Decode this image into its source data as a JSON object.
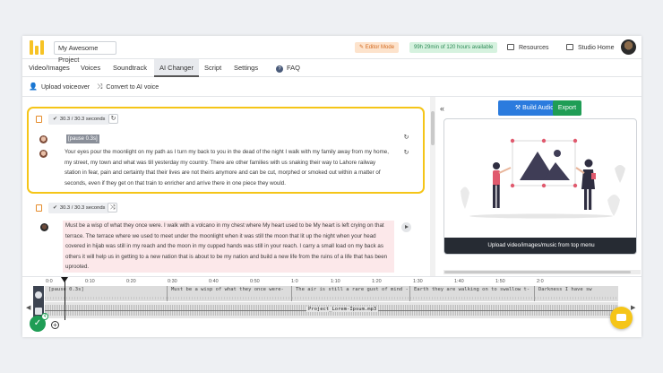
{
  "header": {
    "project_name": "My Awesome Project",
    "editor_mode": "Editor Mode",
    "hours_badge": "99h 29min of 120 hours available",
    "resources": "Resources",
    "studio_home": "Studio Home"
  },
  "tabs": [
    {
      "label": "Video/Images"
    },
    {
      "label": "Voices"
    },
    {
      "label": "Soundtrack"
    },
    {
      "label": "AI Changer"
    },
    {
      "label": "Script"
    },
    {
      "label": "Settings"
    },
    {
      "label": "FAQ"
    }
  ],
  "subbar": {
    "upload": "Upload voiceover",
    "convert": "Convert to AI voice"
  },
  "blocks": [
    {
      "duration": "30.3 / 30.3 seconds",
      "pause_tag": "[pause 0.3s]",
      "text": "Your eyes pour the moonlight on my path as I turn my back to you in the dead of the night I walk with my family away from my home, my street, my town and what was till yesterday my country. There are other families with us snaking their way to Lahore railway station in fear, pain and certainty that their lives are not theirs anymore and can be cut, morphed or smoked out within a matter of seconds, even if they get on that train to enricher and arrive there in one piece they would."
    },
    {
      "duration": "30.3 / 30.3 seconds",
      "text": "Must be a wisp of what they once were. I walk with a volcano in my chest where My heart used to be My heart is left crying on that terrace. The terrace where we used to meet under the moonlight when it was still the moon that lit up the night when your head covered in hijab was still in my reach and the moon in my cupped hands was still in your reach. I carry a small load on my back as others it will help us in getting to a new nation that is about to be my nation and build a new life from the ruins of a life that has been uprooted."
    }
  ],
  "right": {
    "build_audio": "Build Audio",
    "export": "Export",
    "upload_caption": "Upload video/images/music from top menu"
  },
  "timeline": {
    "ticks": [
      "0:0",
      "0:10",
      "0:20",
      "0:30",
      "0:40",
      "0:50",
      "1:0",
      "1:10",
      "1:20",
      "1:30",
      "1:40",
      "1:50",
      "2:0"
    ],
    "segments": [
      "[pause 0.3s]",
      "Must be a wisp of what they once were-",
      "The air is still a rare gust of mind -",
      "Earth they are walking on to swallow t-",
      "Darkness I have sw"
    ],
    "audio_file": "Project_Lorem-Ipsum.mp3",
    "badge_count": "4"
  },
  "colors": {
    "accent_yellow": "#f5c518",
    "build_blue": "#2b7bde",
    "export_green": "#1f9d55",
    "pink_highlight": "#fce8ea"
  }
}
